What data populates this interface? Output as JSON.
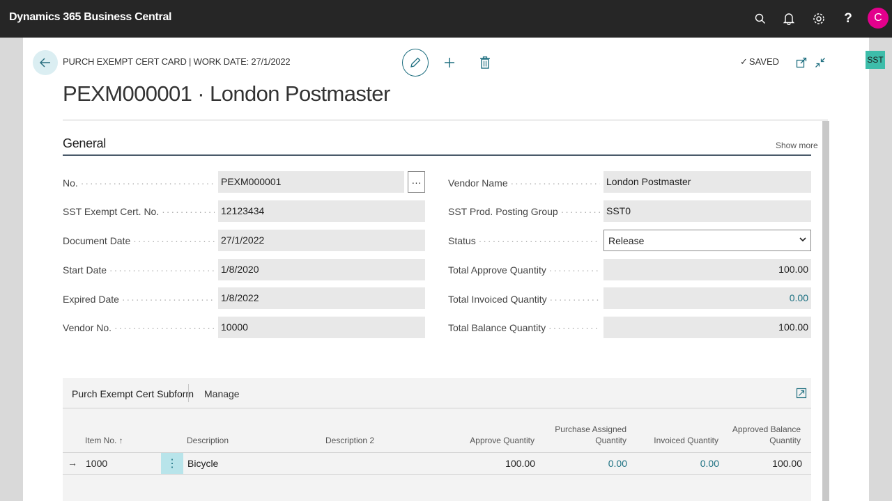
{
  "app": {
    "title": "Dynamics 365 Business Central",
    "user_initial": "C"
  },
  "topbar_icons": [
    "search-icon",
    "bell-icon",
    "gear-icon",
    "help-icon"
  ],
  "help_glyph": "?",
  "side_tab": "SST",
  "header": {
    "caption": "PURCH EXEMPT CERT CARD | WORK DATE: 27/1/2022",
    "title": "PEXM000001 · London Postmaster",
    "saved_label": "SAVED"
  },
  "section": {
    "title": "General",
    "show_more": "Show more"
  },
  "left_fields": [
    {
      "label": "No.",
      "value": "PEXM000001"
    },
    {
      "label": "SST Exempt Cert. No.",
      "value": "12123434"
    },
    {
      "label": "Document Date",
      "value": "27/1/2022"
    },
    {
      "label": "Start Date",
      "value": "1/8/2020"
    },
    {
      "label": "Expired Date",
      "value": "1/8/2022"
    },
    {
      "label": "Vendor No.",
      "value": "10000"
    }
  ],
  "right_fields": [
    {
      "label": "Vendor Name",
      "value": "London Postmaster"
    },
    {
      "label": "SST Prod. Posting Group",
      "value": "SST0"
    },
    {
      "label": "Status",
      "value": "Release"
    },
    {
      "label": "Total Approve Quantity",
      "value": "100.00"
    },
    {
      "label": "Total Invoiced Quantity",
      "value": "0.00"
    },
    {
      "label": "Total Balance Quantity",
      "value": "100.00"
    }
  ],
  "assist_label": "···",
  "subform": {
    "tab_title": "Purch Exempt Cert Subform",
    "manage": "Manage",
    "columns": {
      "item_no": "Item No. ↑",
      "description": "Description",
      "description2": "Description 2",
      "approve_qty": "Approve Quantity",
      "purchase_assigned_1": "Purchase Assigned",
      "purchase_assigned_2": "Quantity",
      "invoiced_qty": "Invoiced Quantity",
      "approved_balance_1": "Approved Balance",
      "approved_balance_2": "Quantity"
    },
    "row": {
      "item_no": "1000",
      "description": "Bicycle",
      "description2": "",
      "approve_qty": "100.00",
      "purchase_assigned": "0.00",
      "invoiced_qty": "0.00",
      "approved_balance": "100.00"
    }
  },
  "colors": {
    "topbar": "#262626",
    "accent": "#1a6f80",
    "avatar": "#e3008c",
    "side_tab": "#3dbdaa"
  }
}
